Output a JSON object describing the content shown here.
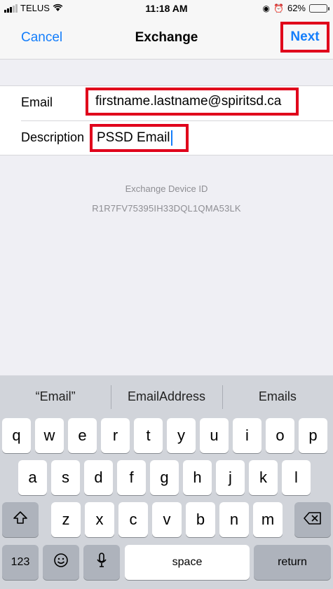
{
  "status_bar": {
    "carrier": "TELUS",
    "time": "11:18 AM",
    "battery": "62%",
    "battery_level": 0.62
  },
  "nav": {
    "cancel_label": "Cancel",
    "title": "Exchange",
    "next_label": "Next"
  },
  "form": {
    "email_label": "Email",
    "email_value": "firstname.lastname@spiritsd.ca",
    "description_label": "Description",
    "description_value": "PSSD Email"
  },
  "device": {
    "label": "Exchange Device ID",
    "id": "R1R7FV75395IH33DQL1QMA53LK"
  },
  "keyboard": {
    "suggestions": [
      "“Email”",
      "EmailAddress",
      "Emails"
    ],
    "row1": [
      "q",
      "w",
      "e",
      "r",
      "t",
      "y",
      "u",
      "i",
      "o",
      "p"
    ],
    "row2": [
      "a",
      "s",
      "d",
      "f",
      "g",
      "h",
      "j",
      "k",
      "l"
    ],
    "row3": [
      "z",
      "x",
      "c",
      "v",
      "b",
      "n",
      "m"
    ],
    "numbers_label": "123",
    "space_label": "space",
    "return_label": "return"
  },
  "colors": {
    "accent": "#147efb",
    "highlight_box": "#e0001b"
  }
}
